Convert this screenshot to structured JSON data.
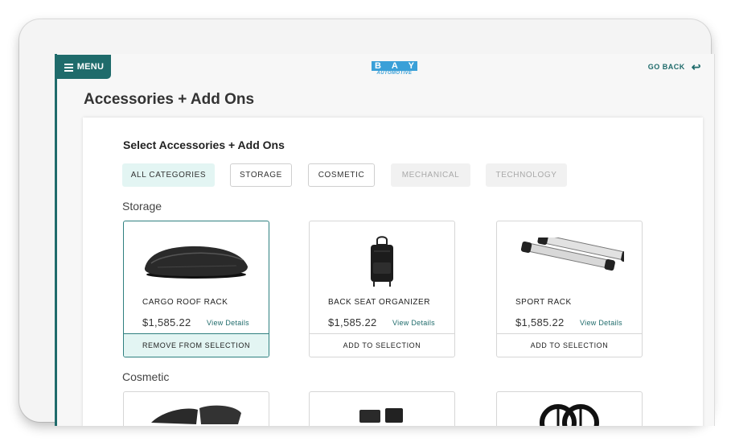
{
  "header": {
    "menu_label": "MENU",
    "logo_word": [
      "B",
      "A",
      "Y"
    ],
    "logo_sub": "AUTOMOTIVE",
    "go_back_label": "GO BACK",
    "go_back_icon": "return-arrow-icon"
  },
  "page": {
    "title": "Accessories + Add Ons"
  },
  "selector": {
    "title": "Select Accessories + Add Ons",
    "filters": [
      {
        "label": "ALL CATEGORIES",
        "state": "active"
      },
      {
        "label": "STORAGE",
        "state": "default"
      },
      {
        "label": "COSMETIC",
        "state": "default"
      },
      {
        "label": "MECHANICAL",
        "state": "disabled"
      },
      {
        "label": "TECHNOLOGY",
        "state": "disabled"
      }
    ]
  },
  "sections": {
    "storage": {
      "title": "Storage",
      "products": [
        {
          "name": "CARGO ROOF RACK",
          "price": "$1,585.22",
          "link": "View Details",
          "action": "REMOVE FROM SELECTION",
          "selected": true
        },
        {
          "name": "BACK SEAT ORGANIZER",
          "price": "$1,585.22",
          "link": "View Details",
          "action": "ADD TO SELECTION",
          "selected": false
        },
        {
          "name": "SPORT RACK",
          "price": "$1,585.22",
          "link": "View Details",
          "action": "ADD TO SELECTION",
          "selected": false
        }
      ]
    },
    "cosmetic": {
      "title": "Cosmetic"
    }
  },
  "colors": {
    "accent": "#1f6b6b",
    "chip_active_bg": "#e3f5f3",
    "logo_blue": "#3aa0d8"
  }
}
